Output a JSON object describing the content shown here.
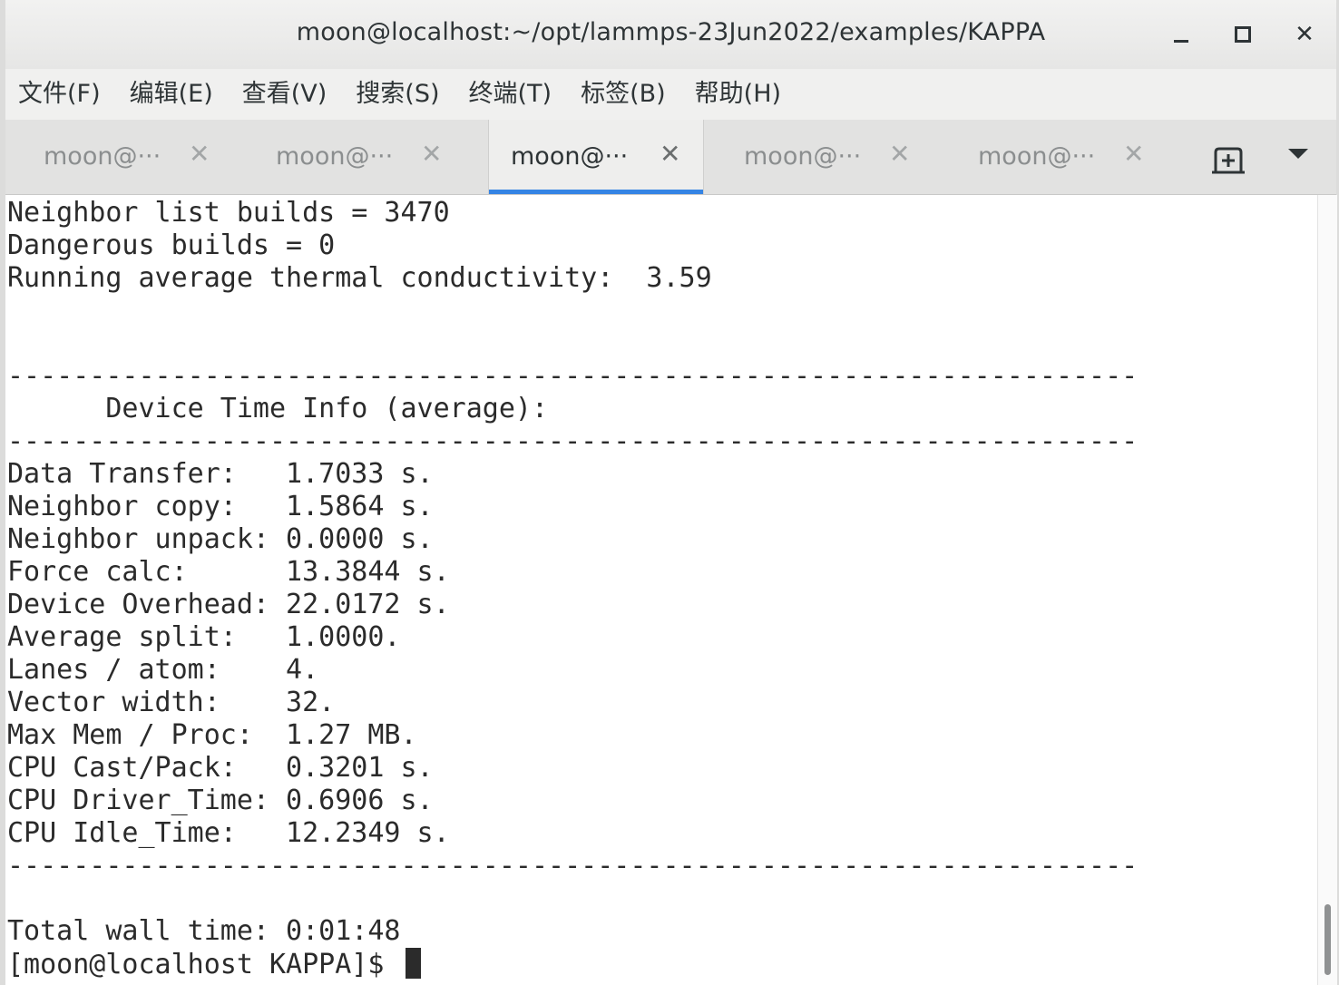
{
  "window": {
    "title": "moon@localhost:~/opt/lammps-23Jun2022/examples/KAPPA",
    "close_glyph": "✕"
  },
  "menu": [
    "文件(F)",
    "编辑(E)",
    "查看(V)",
    "搜索(S)",
    "终端(T)",
    "标签(B)",
    "帮助(H)"
  ],
  "tabs": [
    {
      "label": "moon@···",
      "close": "✕",
      "active": false
    },
    {
      "label": "moon@···",
      "close": "✕",
      "active": false
    },
    {
      "label": "moon@···",
      "close": "✕",
      "active": true
    },
    {
      "label": "moon@···",
      "close": "✕",
      "active": false
    },
    {
      "label": "moon@···",
      "close": "✕",
      "active": false
    }
  ],
  "icons": {
    "new_tab": "new-tab-icon",
    "tab_menu": "tab-menu-icon",
    "minimize": "minimize-icon",
    "maximize": "maximize-icon",
    "close": "close-icon"
  },
  "colors": {
    "accent": "#3584e4",
    "terminal_bg": "#ffffff",
    "terminal_fg": "#2b2b2b"
  },
  "terminal": {
    "lines": [
      "Neighbor list builds = 3470",
      "Dangerous builds = 0",
      "Running average thermal conductivity:  3.59",
      "",
      "",
      "---------------------------------------------------------------------",
      "      Device Time Info (average):",
      "---------------------------------------------------------------------",
      "Data Transfer:   1.7033 s.",
      "Neighbor copy:   1.5864 s.",
      "Neighbor unpack: 0.0000 s.",
      "Force calc:      13.3844 s.",
      "Device Overhead: 22.0172 s.",
      "Average split:   1.0000.",
      "Lanes / atom:    4.",
      "Vector width:    32.",
      "Max Mem / Proc:  1.27 MB.",
      "CPU Cast/Pack:   0.3201 s.",
      "CPU Driver_Time: 0.6906 s.",
      "CPU Idle_Time:   12.2349 s.",
      "---------------------------------------------------------------------",
      "",
      "Total wall time: 0:01:48"
    ],
    "prompt": "[moon@localhost KAPPA]$ "
  }
}
